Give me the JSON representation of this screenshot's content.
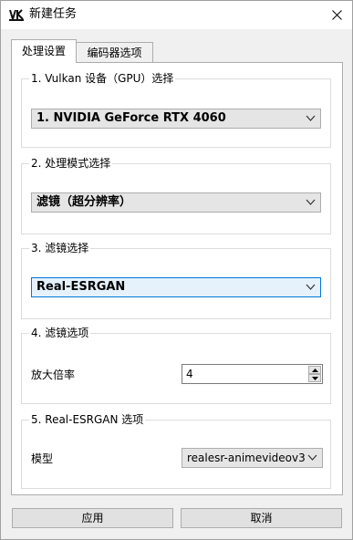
{
  "window": {
    "title": "新建任务",
    "app_icon": "vk-app-icon",
    "close_icon": "close-icon"
  },
  "tabs": [
    {
      "label": "处理设置",
      "active": true
    },
    {
      "label": "编码器选项",
      "active": false
    }
  ],
  "groups": {
    "device": {
      "title": "1. Vulkan 设备（GPU）选择",
      "selected": "1. NVIDIA GeForce RTX 4060"
    },
    "mode": {
      "title": "2. 处理模式选择",
      "selected": "滤镜（超分辨率）"
    },
    "filter": {
      "title": "3. 滤镜选择",
      "selected": "Real-ESRGAN"
    },
    "filter_options": {
      "title": "4. 滤镜选项",
      "scale_label": "放大倍率",
      "scale_value": "4"
    },
    "esrgan_options": {
      "title": "5. Real-ESRGAN 选项",
      "model_label": "模型",
      "model_value": "realesr-animevideov3"
    }
  },
  "buttons": {
    "apply": "应用",
    "cancel": "取消"
  },
  "colors": {
    "focus_border": "#0078d7",
    "focus_fill": "#e5f1fb"
  }
}
